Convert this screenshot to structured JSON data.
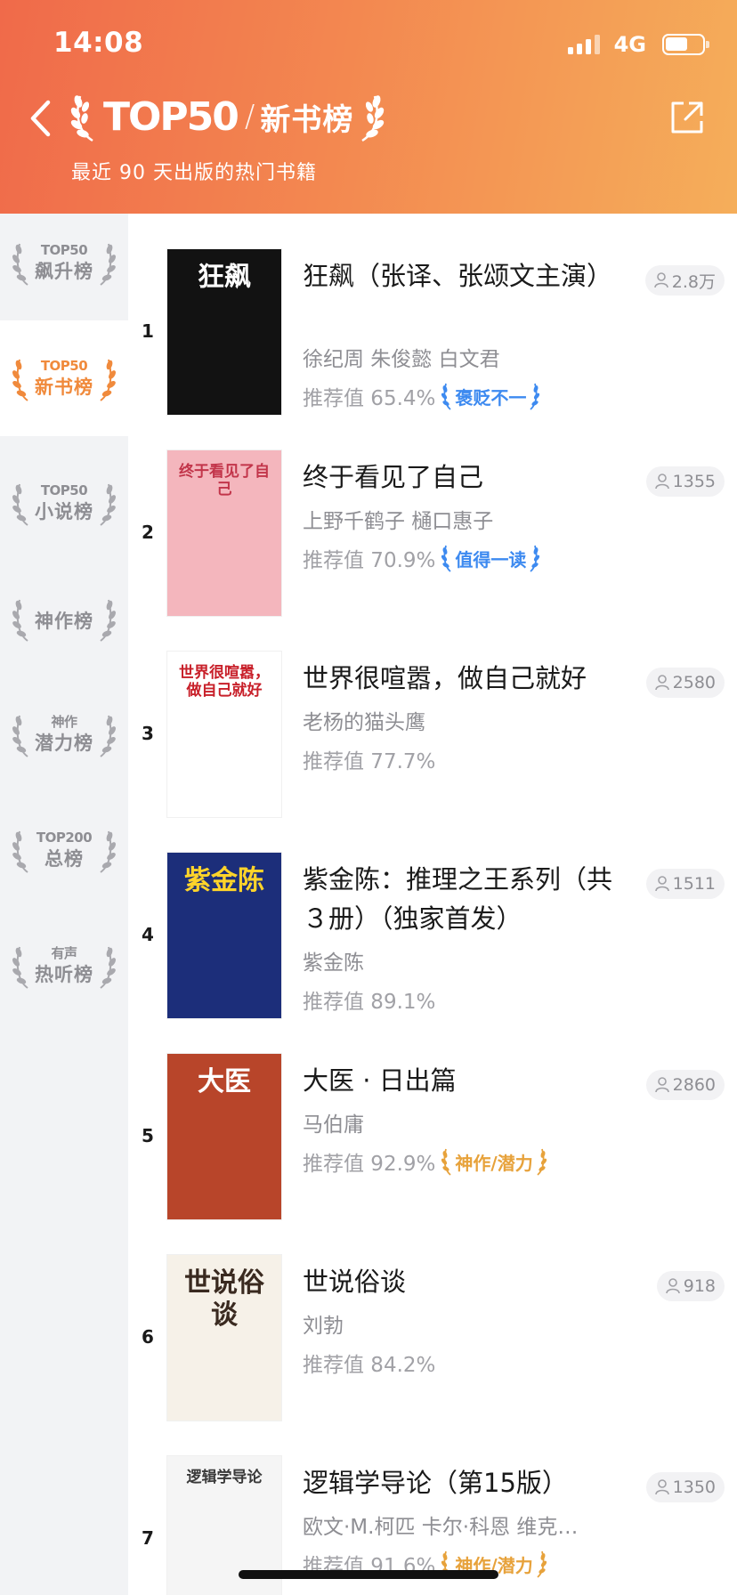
{
  "status_bar": {
    "time": "14:08",
    "network": "4G"
  },
  "header": {
    "brand": "TOP50",
    "separator": "/",
    "list_name": "新书榜",
    "subtitle": "最近 90 天出版的热门书籍"
  },
  "sidebar": {
    "items": [
      {
        "top": "TOP50",
        "bottom": "飙升榜",
        "active": false
      },
      {
        "top": "TOP50",
        "bottom": "新书榜",
        "active": true
      },
      {
        "top": "TOP50",
        "bottom": "小说榜",
        "active": false
      },
      {
        "top": "",
        "bottom": "神作榜",
        "active": false
      },
      {
        "top": "神作",
        "bottom": "潜力榜",
        "active": false
      },
      {
        "top": "TOP200",
        "bottom": "总榜",
        "active": false
      },
      {
        "top": "有声",
        "bottom": "热听榜",
        "active": false
      }
    ]
  },
  "books": [
    {
      "rank": "1",
      "title": "狂飙（张译、张颂文主演）",
      "author": "徐纪周 朱俊懿 白文君",
      "score": "推荐值 65.4%",
      "badge": "褒贬不一",
      "badge_color": "#3d8af0",
      "readers": "2.8万",
      "cover": {
        "bg": "#121212",
        "fg": "#ffffff",
        "text": "狂飙"
      }
    },
    {
      "rank": "2",
      "title": "终于看见了自己",
      "author": "上野千鹤子 樋口惠子",
      "score": "推荐值 70.9%",
      "badge": "值得一读",
      "badge_color": "#3d8af0",
      "readers": "1355",
      "cover": {
        "bg": "#f4b6bd",
        "fg": "#c2354a",
        "text": "终于看见了自己"
      }
    },
    {
      "rank": "3",
      "title": "世界很喧嚣，做自己就好",
      "author": "老杨的猫头鹰",
      "score": "推荐值 77.7%",
      "badge": "",
      "badge_color": "",
      "readers": "2580",
      "cover": {
        "bg": "#ffffff",
        "fg": "#c8202a",
        "text": "世界很喧嚣，做自己就好"
      }
    },
    {
      "rank": "4",
      "title": "紫金陈：推理之王系列（共３册）（独家首发）",
      "author": "紫金陈",
      "score": "推荐值 89.1%",
      "badge": "",
      "badge_color": "",
      "readers": "1511",
      "cover": {
        "bg": "#1c2e7a",
        "fg": "#ffd42a",
        "text": "紫金陈"
      }
    },
    {
      "rank": "5",
      "title": "大医 · 日出篇",
      "author": "马伯庸",
      "score": "推荐值 92.9%",
      "badge": "神作/潜力",
      "badge_color": "#e7a23b",
      "readers": "2860",
      "cover": {
        "bg": "#b8452a",
        "fg": "#ffffff",
        "text": "大医"
      }
    },
    {
      "rank": "6",
      "title": "世说俗谈",
      "author": "刘勃",
      "score": "推荐值 84.2%",
      "badge": "",
      "badge_color": "",
      "readers": "918",
      "cover": {
        "bg": "#f6f1e8",
        "fg": "#3a2a20",
        "text": "世说俗谈"
      }
    },
    {
      "rank": "7",
      "title": "逻辑学导论（第15版）",
      "author": "欧文·M.柯匹 卡尔·科恩 维克…",
      "score": "推荐值 91.6%",
      "badge": "神作/潜力",
      "badge_color": "#e7a23b",
      "readers": "1350",
      "cover": {
        "bg": "#f5f5f5",
        "fg": "#3a3a3a",
        "text": "逻辑学导论"
      }
    }
  ]
}
